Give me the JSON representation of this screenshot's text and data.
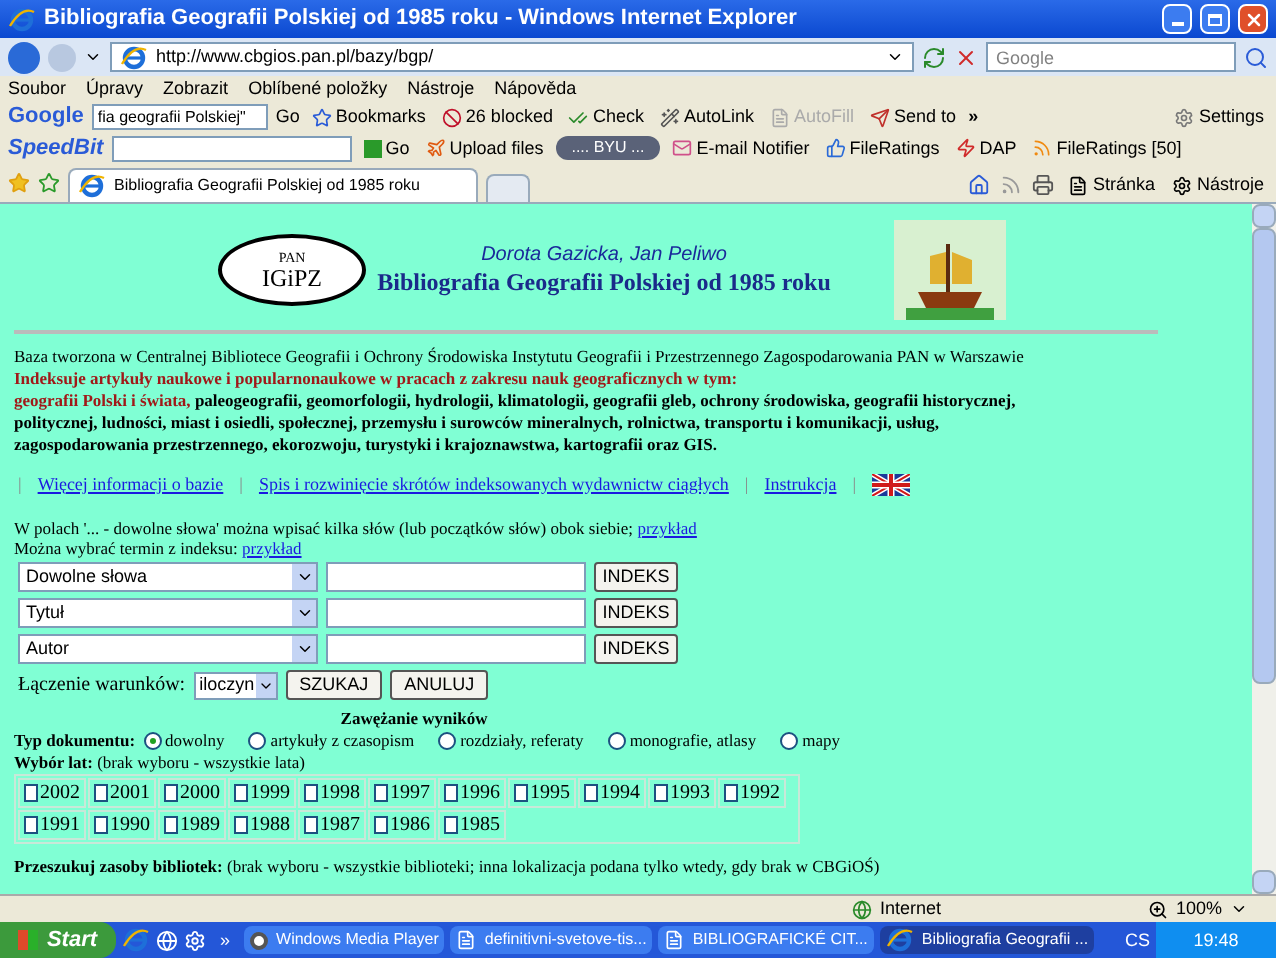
{
  "window": {
    "title": "Bibliografia Geografii Polskiej od 1985 roku - Windows Internet Explorer"
  },
  "address_bar": {
    "url": "http://www.cbgios.pan.pl/bazy/bgp/",
    "search_placeholder": "Google"
  },
  "menu": [
    "Soubor",
    "Úpravy",
    "Zobrazit",
    "Oblíbené položky",
    "Nástroje",
    "Nápověda"
  ],
  "google_toolbar": {
    "logo": "Google",
    "query": "fia geografii Polskiej\"",
    "go": "Go",
    "items": [
      {
        "kind": "star",
        "label": "Bookmarks",
        "disabled": false
      },
      {
        "kind": "block",
        "label": "26 blocked",
        "disabled": false
      },
      {
        "kind": "check",
        "label": "Check",
        "disabled": false
      },
      {
        "kind": "wand",
        "label": "AutoLink",
        "disabled": false
      },
      {
        "kind": "fill",
        "label": "AutoFill",
        "disabled": true
      },
      {
        "kind": "send",
        "label": "Send to",
        "disabled": false
      }
    ],
    "more": "»",
    "settings": "Settings"
  },
  "speedbit_toolbar": {
    "logo": "SpeedBit",
    "go": "Go",
    "upload": "Upload files",
    "player": ".... BYU ...",
    "items": [
      {
        "kind": "mail",
        "label": "E-mail Notifier"
      },
      {
        "kind": "rating",
        "label": "FileRatings"
      },
      {
        "kind": "dap",
        "label": "DAP"
      },
      {
        "kind": "rss",
        "label": "FileRatings [50]"
      }
    ]
  },
  "tabs": [
    {
      "label": "Bibliografia Geografii Polskiej od 1985 roku",
      "selected": true
    }
  ],
  "command_bar": [
    "Stránka",
    "Nástroje"
  ],
  "page": {
    "logo": {
      "top": "PAN",
      "main": "IGiPZ"
    },
    "authors": "Dorota Gazicka, Jan Peliwo",
    "title": "Bibliografia Geografii Polskiej od 1985 roku",
    "intro": "Baza tworzona w Centralnej Bibliotece Geografii i Ochrony Środowiska Instytutu Geografii i Przestrzennego Zagospodarowania PAN w Warszawie",
    "scope_heading": "Indeksuje artykuły naukowe i popularnonaukowe w pracach z zakresu nauk geograficznych w tym:",
    "scope_highlight": "geografii Polski i świata,",
    "scope_rest": "paleogeografii, geomorfologii, hydrologii, klimatologii, geografii gleb, ochrony środowiska, geografii historycznej, politycznej, ludności, miast i osiedli, społecznej, przemysłu i surowców mineralnych, rolnictwa, transportu i komunikacji, usług, zagospodarowania przestrzennego, ekorozwoju, turystyki i krajoznawstwa, kartografii oraz GIS.",
    "separator": "|",
    "links": [
      "Więcej informacji o bazie",
      "Spis i rozwinięcie skrótów indeksowanych wydawnictw ciągłych",
      "Instrukcja"
    ],
    "hint1": "W polach '... - dowolne słowa' można wpisać kilka słów (lub początków słów) obok siebie;",
    "hint1_link": "przykład",
    "hint2": "Można wybrać termin z indeksu:",
    "hint2_link": "przykład",
    "search_rows": [
      {
        "field": "Dowolne słowa",
        "button": "INDEKS"
      },
      {
        "field": "Tytuł",
        "button": "INDEKS"
      },
      {
        "field": "Autor",
        "button": "INDEKS"
      }
    ],
    "combine_label": "Łączenie warunków:",
    "combine_value": "iloczyn",
    "search_button": "SZUKAJ",
    "cancel_button": "ANULUJ",
    "narrow_heading": "Zawężanie wyników",
    "doc_type_label": "Typ dokumentu:",
    "doc_types": [
      {
        "label": "dowolny",
        "selected": true
      },
      {
        "label": "artykuły z czasopism",
        "selected": false
      },
      {
        "label": "rozdziały, referaty",
        "selected": false
      },
      {
        "label": "monografie, atlasy",
        "selected": false
      },
      {
        "label": "mapy",
        "selected": false
      }
    ],
    "years_label": "Wybór lat:",
    "years_hint": "(brak wyboru - wszystkie lata)",
    "years": [
      {
        "label": "2002",
        "checked": false
      },
      {
        "label": "2001",
        "checked": false
      },
      {
        "label": "2000",
        "checked": false
      },
      {
        "label": "1999",
        "checked": false
      },
      {
        "label": "1998",
        "checked": false
      },
      {
        "label": "1997",
        "checked": false
      },
      {
        "label": "1996",
        "checked": false
      },
      {
        "label": "1995",
        "checked": false
      },
      {
        "label": "1994",
        "checked": false
      },
      {
        "label": "1993",
        "checked": false
      },
      {
        "label": "1992",
        "checked": false
      },
      {
        "label": "1991",
        "checked": false
      },
      {
        "label": "1990",
        "checked": false
      },
      {
        "label": "1989",
        "checked": false
      },
      {
        "label": "1988",
        "checked": false
      },
      {
        "label": "1987",
        "checked": false
      },
      {
        "label": "1986",
        "checked": false
      },
      {
        "label": "1985",
        "checked": false
      }
    ],
    "libraries_label": "Przeszukuj zasoby bibliotek:",
    "libraries_hint": "(brak wyboru - wszystkie biblioteki; inna lokalizacja podana tylko wtedy, gdy brak w CBGiOŚ)"
  },
  "status_bar": {
    "zone": "Internet",
    "zoom": "100%"
  },
  "taskbar": {
    "start": "Start",
    "more": "»",
    "tasks": [
      {
        "kind": "media",
        "label": "Windows Media Player",
        "selected": false
      },
      {
        "kind": "doc",
        "label": "definitivni-svetove-tis...",
        "selected": false
      },
      {
        "kind": "doc",
        "label": "BIBLIOGRAFICKÉ CIT...",
        "selected": false
      },
      {
        "kind": "ie",
        "label": "Bibliografia Geografii ...",
        "selected": true
      }
    ],
    "language": "CS",
    "time": "19:48"
  }
}
